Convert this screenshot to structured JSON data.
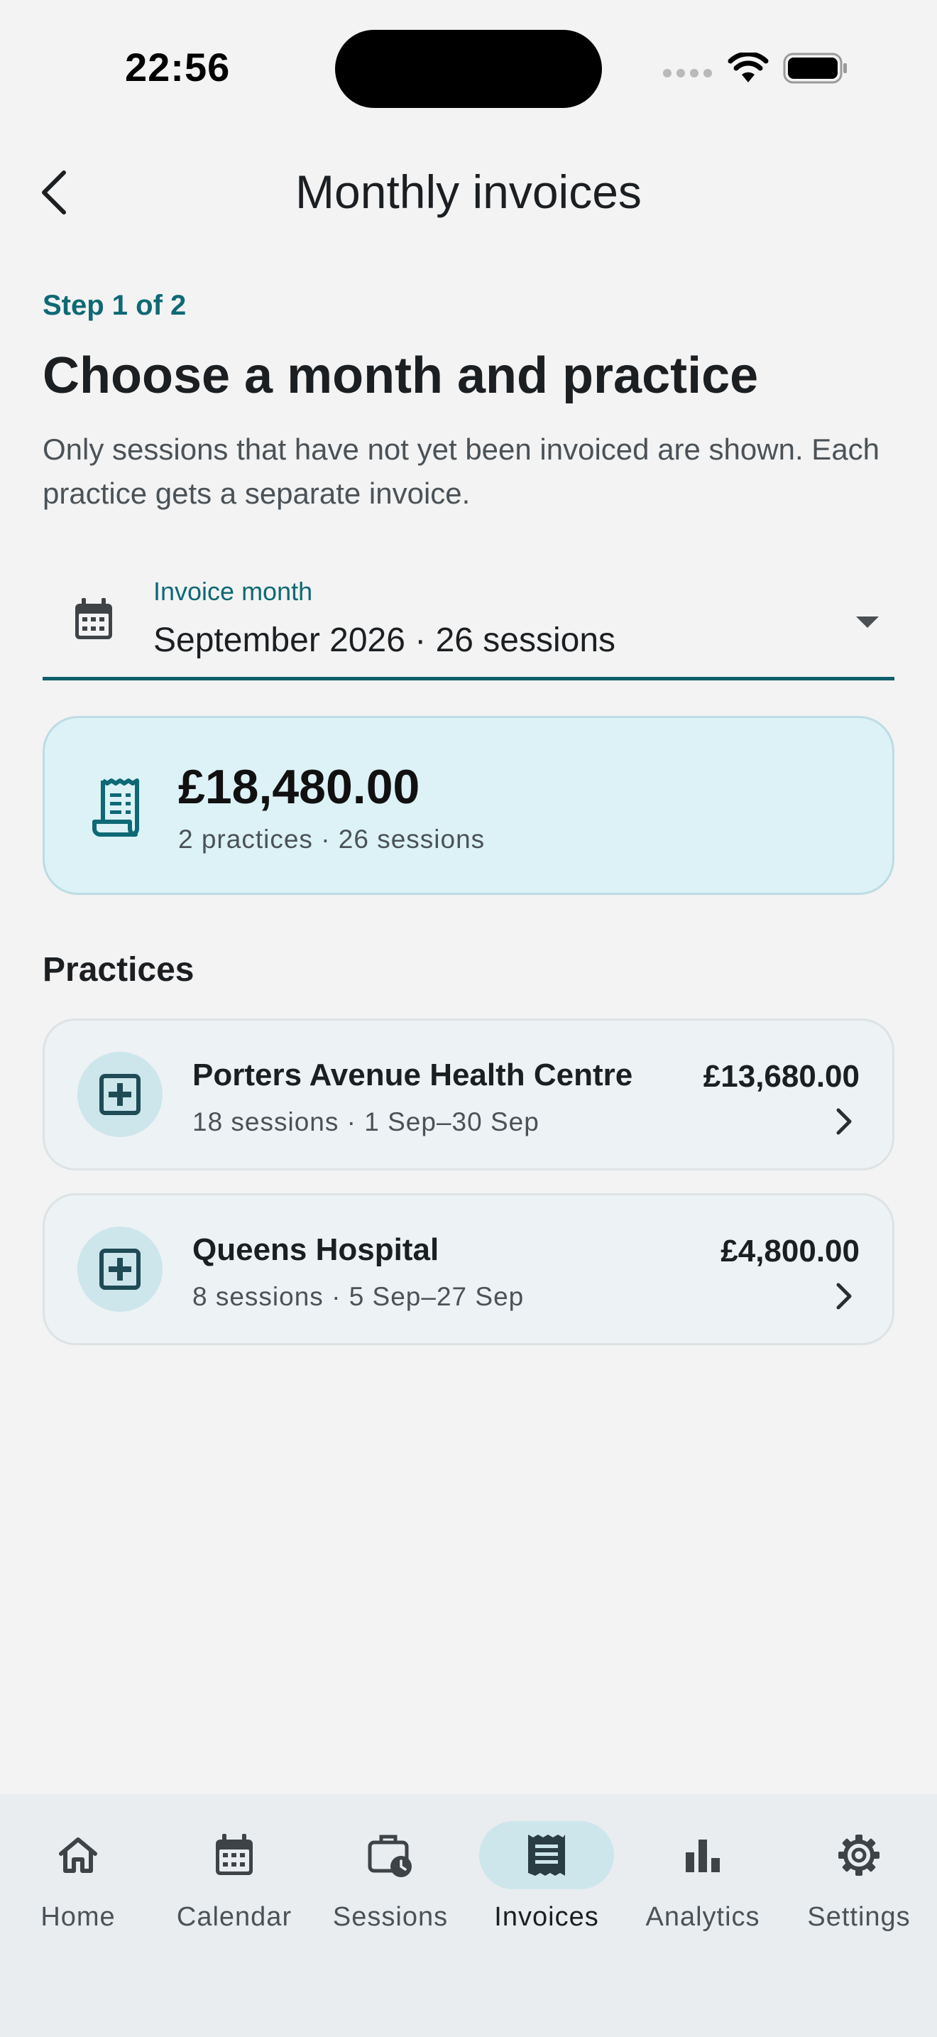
{
  "status_bar": {
    "time": "22:56"
  },
  "header": {
    "title": "Monthly invoices"
  },
  "step": {
    "label": "Step 1 of 2"
  },
  "heading": "Choose a month and practice",
  "description": "Only sessions that have not yet been invoiced are shown. Each practice gets a separate invoice.",
  "month_select": {
    "label": "Invoice month",
    "value": "September 2026 · 26 sessions"
  },
  "summary": {
    "amount": "£18,480.00",
    "detail": "2 practices · 26 sessions"
  },
  "practices_title": "Practices",
  "practices": [
    {
      "name": "Porters Avenue Health Centre",
      "meta": "18 sessions · 1 Sep–30 Sep",
      "amount": "£13,680.00"
    },
    {
      "name": "Queens Hospital",
      "meta": "8 sessions · 5 Sep–27 Sep",
      "amount": "£4,800.00"
    }
  ],
  "nav": [
    {
      "label": "Home",
      "icon": "home-icon"
    },
    {
      "label": "Calendar",
      "icon": "calendar-icon"
    },
    {
      "label": "Sessions",
      "icon": "briefcase-clock-icon"
    },
    {
      "label": "Invoices",
      "icon": "receipt-icon",
      "active": true
    },
    {
      "label": "Analytics",
      "icon": "bar-chart-icon"
    },
    {
      "label": "Settings",
      "icon": "gear-icon"
    }
  ],
  "colors": {
    "accent": "#0e6975",
    "card_bg": "#dcf2f7",
    "nav_active_bg": "#cde6eb"
  }
}
